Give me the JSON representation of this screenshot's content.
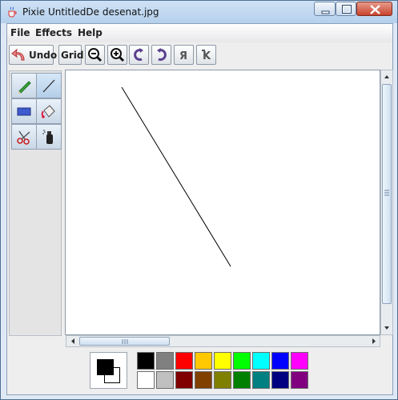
{
  "window": {
    "title": "Pixie UntitledDe desenat.jpg"
  },
  "menu": {
    "file": "File",
    "effects": "Effects",
    "help": "Help"
  },
  "toolbar": {
    "undo_label": "Undo",
    "grid_label": "Grid"
  },
  "palette_top": [
    "#000000",
    "#808080",
    "#ff0000",
    "#ffc800",
    "#ffff00",
    "#00ff00",
    "#00ffff",
    "#0000ff",
    "#ff00ff"
  ],
  "palette_bottom": [
    "#ffffff",
    "#c0c0c0",
    "#800000",
    "#804000",
    "#808000",
    "#008000",
    "#008080",
    "#000080",
    "#800080"
  ],
  "current_colors": {
    "primary": "#000000",
    "secondary": "#ffffff"
  },
  "tools": [
    "pencil-icon",
    "line-icon",
    "rectangle-icon",
    "paint-bucket-icon",
    "scissors-icon",
    "spray-can-icon"
  ],
  "selected_tool": "line-icon"
}
